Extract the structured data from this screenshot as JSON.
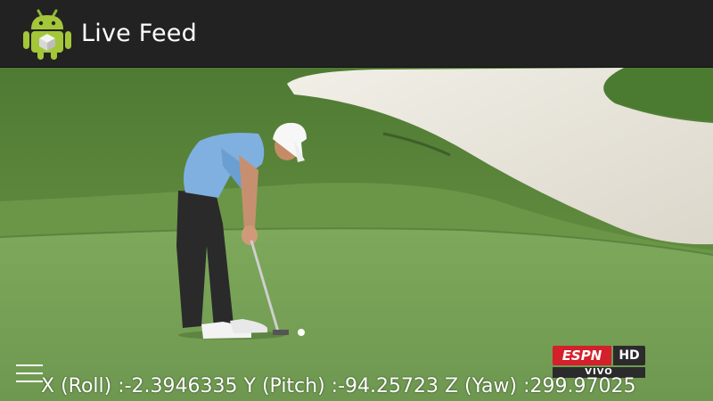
{
  "action_bar": {
    "title": "Live Feed",
    "app_icon": "android-robot-icon"
  },
  "video": {
    "broadcaster_logo": "ESPN",
    "quality_badge": "HD",
    "live_badge": "VIVO"
  },
  "sensor": {
    "readout": "X (Roll) :-2.3946335 Y (Pitch) :-94.25723 Z (Yaw) :299.97025"
  },
  "controls": {
    "menu_icon": "hamburger-menu-icon"
  },
  "colors": {
    "action_bar_bg": "#222222",
    "android_green": "#a4c639",
    "espn_red": "#d3202a"
  }
}
